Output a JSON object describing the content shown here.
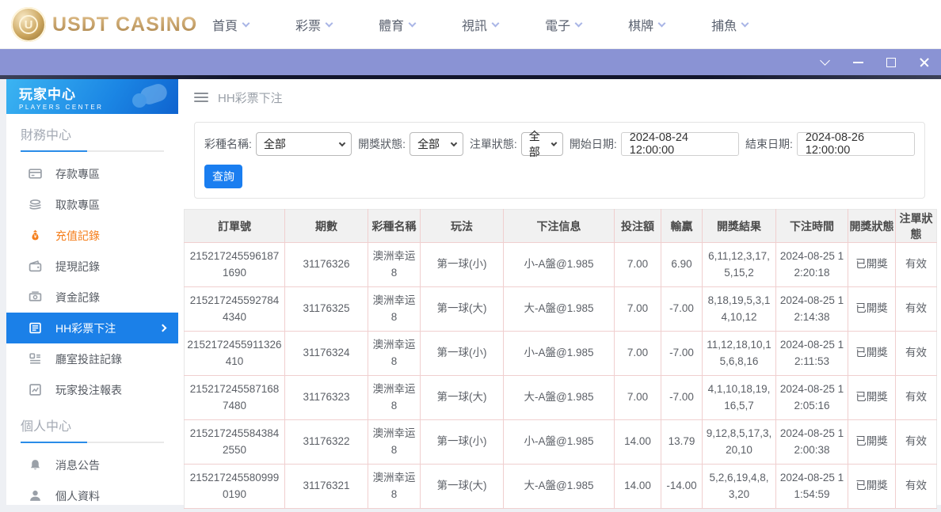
{
  "header": {
    "logo_badge": "U",
    "logo_text": "USDT CASINO"
  },
  "nav": {
    "items": [
      "首頁",
      "彩票",
      "體育",
      "視訊",
      "電子",
      "棋牌",
      "捕魚"
    ]
  },
  "sidebar": {
    "title": "玩家中心",
    "subtitle": "PLAYERS CENTER",
    "sections": [
      {
        "title": "財務中心",
        "items": [
          {
            "label": "存款專區",
            "icon": "deposit-icon",
            "state": "normal"
          },
          {
            "label": "取款專區",
            "icon": "withdraw-icon",
            "state": "normal"
          },
          {
            "label": "充值記錄",
            "icon": "recharge-record-icon",
            "state": "highlight-orange"
          },
          {
            "label": "提現記錄",
            "icon": "cashout-record-icon",
            "state": "normal"
          },
          {
            "label": "資金記錄",
            "icon": "funds-record-icon",
            "state": "normal"
          },
          {
            "label": "HH彩票下注",
            "icon": "lottery-bets-icon",
            "state": "active"
          },
          {
            "label": "廳室投註記錄",
            "icon": "hall-bets-icon",
            "state": "normal"
          },
          {
            "label": "玩家投注報表",
            "icon": "player-report-icon",
            "state": "normal"
          }
        ]
      },
      {
        "title": "個人中心",
        "items": [
          {
            "label": "消息公告",
            "icon": "bell-icon",
            "state": "normal"
          },
          {
            "label": "個人資料",
            "icon": "person-icon",
            "state": "normal"
          }
        ]
      }
    ]
  },
  "breadcrumb": {
    "title": "HH彩票下注"
  },
  "filters": {
    "lottery_label": "彩種名稱:",
    "lottery_value": "全部",
    "draw_status_label": "開獎狀態:",
    "draw_status_value": "全部",
    "order_status_label": "注單狀態:",
    "order_status_value": "全部",
    "start_date_label": "開始日期:",
    "start_date_value": "2024-08-24 12:00:00",
    "end_date_label": "結束日期:",
    "end_date_value": "2024-08-26 12:00:00",
    "search_button": "查詢"
  },
  "table": {
    "headers": [
      "訂單號",
      "期數",
      "彩種名稱",
      "玩法",
      "下注信息",
      "投注額",
      "輸贏",
      "開獎結果",
      "下注時間",
      "開獎狀態",
      "注單狀態"
    ],
    "rows": [
      [
        "2152172455961871690",
        "31176326",
        "澳洲幸运8",
        "第一球(小)",
        "小-A盤@1.985",
        "7.00",
        "6.90",
        "6,11,12,3,17,5,15,2",
        "2024-08-25 12:20:18",
        "已開獎",
        "有效"
      ],
      [
        "2152172455927844340",
        "31176325",
        "澳洲幸运8",
        "第一球(大)",
        "大-A盤@1.985",
        "7.00",
        "-7.00",
        "8,18,19,5,3,14,10,12",
        "2024-08-25 12:14:38",
        "已開獎",
        "有效"
      ],
      [
        "2152172455911326410",
        "31176324",
        "澳洲幸运8",
        "第一球(小)",
        "小-A盤@1.985",
        "7.00",
        "-7.00",
        "11,12,18,10,15,6,8,16",
        "2024-08-25 12:11:53",
        "已開獎",
        "有效"
      ],
      [
        "2152172455871687480",
        "31176323",
        "澳洲幸运8",
        "第一球(大)",
        "大-A盤@1.985",
        "7.00",
        "-7.00",
        "4,1,10,18,19,16,5,7",
        "2024-08-25 12:05:16",
        "已開獎",
        "有效"
      ],
      [
        "2152172455843842550",
        "31176322",
        "澳洲幸运8",
        "第一球(小)",
        "小-A盤@1.985",
        "14.00",
        "13.79",
        "9,12,8,5,17,3,20,10",
        "2024-08-25 12:00:38",
        "已開獎",
        "有效"
      ],
      [
        "2152172455809990190",
        "31176321",
        "澳洲幸运8",
        "第一球(大)",
        "大-A盤@1.985",
        "14.00",
        "-14.00",
        "5,2,6,19,4,8,3,20",
        "2024-08-25 11:54:59",
        "已開獎",
        "有效"
      ]
    ]
  },
  "colors": {
    "accent_blue": "#1b80e8",
    "highlight_orange": "#f57e1b",
    "titlebar_purple": "#8a93d4",
    "sidebar_gradient_start": "#3bb4f2",
    "sidebar_gradient_end": "#0f63cf",
    "table_border_pink": "#f0cfcf",
    "logo_gold": "#caa45c"
  }
}
